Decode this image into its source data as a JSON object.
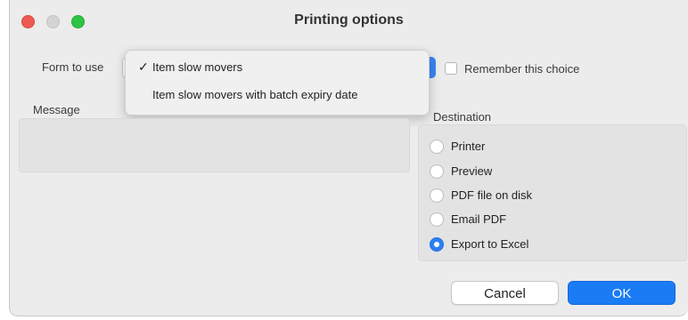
{
  "window": {
    "title": "Printing options"
  },
  "form": {
    "label": "Form to use",
    "options": [
      {
        "label": "Item slow movers",
        "checked": true
      },
      {
        "label": "Item slow movers with batch expiry date",
        "checked": false
      }
    ],
    "checkmark": "✓"
  },
  "remember": {
    "label": "Remember this choice",
    "checked": false
  },
  "message": {
    "label": "Message",
    "value": ""
  },
  "destination": {
    "label": "Destination",
    "options": [
      {
        "label": "Printer",
        "selected": false
      },
      {
        "label": "Preview",
        "selected": false
      },
      {
        "label": "PDF file on disk",
        "selected": false
      },
      {
        "label": "Email PDF",
        "selected": false
      },
      {
        "label": "Export to Excel",
        "selected": true
      }
    ]
  },
  "buttons": {
    "cancel": "Cancel",
    "ok": "OK"
  },
  "colors": {
    "accent": "#1b7bf5",
    "close": "#ee5a52",
    "zoom": "#2fc443"
  }
}
